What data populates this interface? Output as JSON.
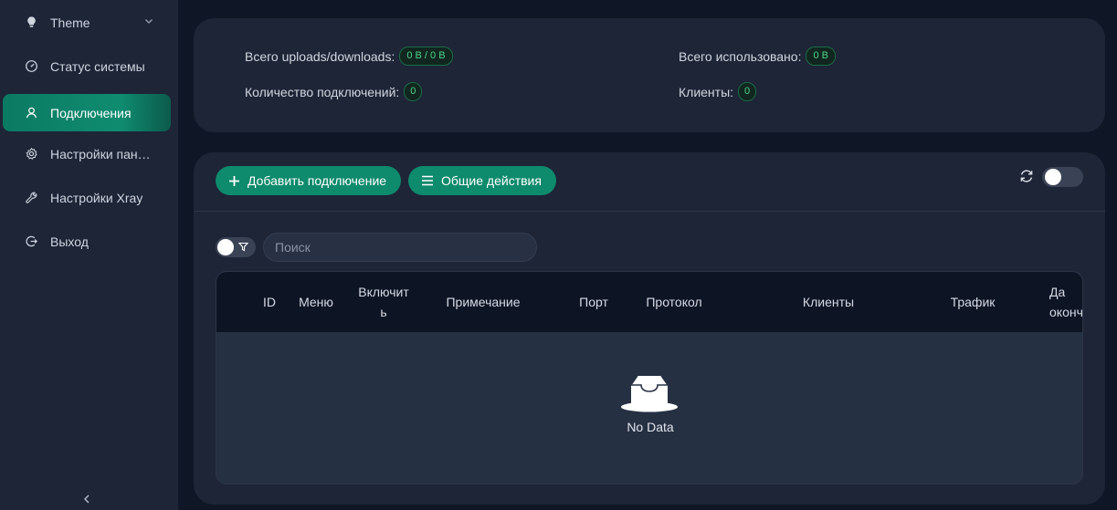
{
  "sidebar": {
    "items": [
      {
        "label": "Theme",
        "icon": "bulb-icon"
      },
      {
        "label": "Статус системы",
        "icon": "dashboard-icon"
      },
      {
        "label": "Подключения",
        "icon": "user-icon",
        "active": true
      },
      {
        "label": "Настройки пан…",
        "icon": "gear-icon"
      },
      {
        "label": "Настройки Xray",
        "icon": "wrench-icon"
      },
      {
        "label": "Выход",
        "icon": "logout-icon"
      }
    ]
  },
  "stats": {
    "total_traffic_label": "Всего uploads/downloads:",
    "total_traffic_value": "0 B / 0 B",
    "total_used_label": "Всего использовано:",
    "total_used_value": "0 B",
    "connections_label": "Количество подключений:",
    "connections_value": "0",
    "clients_label": "Клиенты:",
    "clients_value": "0"
  },
  "toolbar": {
    "add_label": "Добавить подключение",
    "general_actions_label": "Общие действия"
  },
  "search": {
    "placeholder": "Поиск"
  },
  "table": {
    "columns": [
      "ID",
      "Меню",
      "Включить",
      "Примечание",
      "Порт",
      "Протокол",
      "Клиенты",
      "Трафик",
      "Дата окончания"
    ],
    "columns_display": [
      "ID",
      "Меню",
      "Включит\nь",
      "Примечание",
      "Порт",
      "Протокол",
      "Клиенты",
      "Трафик",
      "Да\nоконч"
    ],
    "rows": [],
    "empty_text": "No Data"
  },
  "colors": {
    "accent": "#0e8a6c",
    "background": "#0f1626",
    "card": "#1d2537",
    "badge_text": "#4fd38b"
  }
}
